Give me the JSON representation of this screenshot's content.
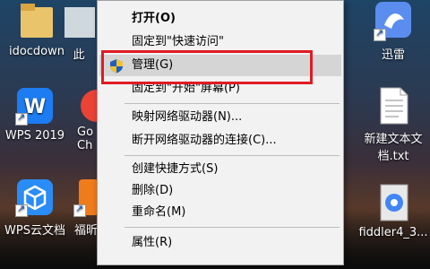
{
  "desktop": {
    "icons": [
      {
        "label": "idocdown"
      },
      {
        "label": "此"
      },
      {
        "label": "WPS 2019"
      },
      {
        "label": "Go"
      },
      {
        "label": "Ch"
      },
      {
        "label": "WPS云文档"
      },
      {
        "label": "福昕"
      },
      {
        "label": "迅雷"
      },
      {
        "label": "新建文本文档.txt"
      },
      {
        "label": "fiddler4_3..."
      }
    ]
  },
  "context_menu": {
    "items": [
      {
        "label": "打开(O)"
      },
      {
        "label": "固定到\"快速访问\""
      },
      {
        "label": "管理(G)"
      },
      {
        "label": "固定到\"开始\"屏幕(P)"
      },
      {
        "label": "映射网络驱动器(N)..."
      },
      {
        "label": "断开网络驱动器的连接(C)..."
      },
      {
        "label": "创建快捷方式(S)"
      },
      {
        "label": "删除(D)"
      },
      {
        "label": "重命名(M)"
      },
      {
        "label": "属性(R)"
      }
    ]
  },
  "colors": {
    "highlight_border": "#e01b24",
    "menu_background": "#f2f2f2",
    "menu_highlight": "#d5d5d5"
  }
}
